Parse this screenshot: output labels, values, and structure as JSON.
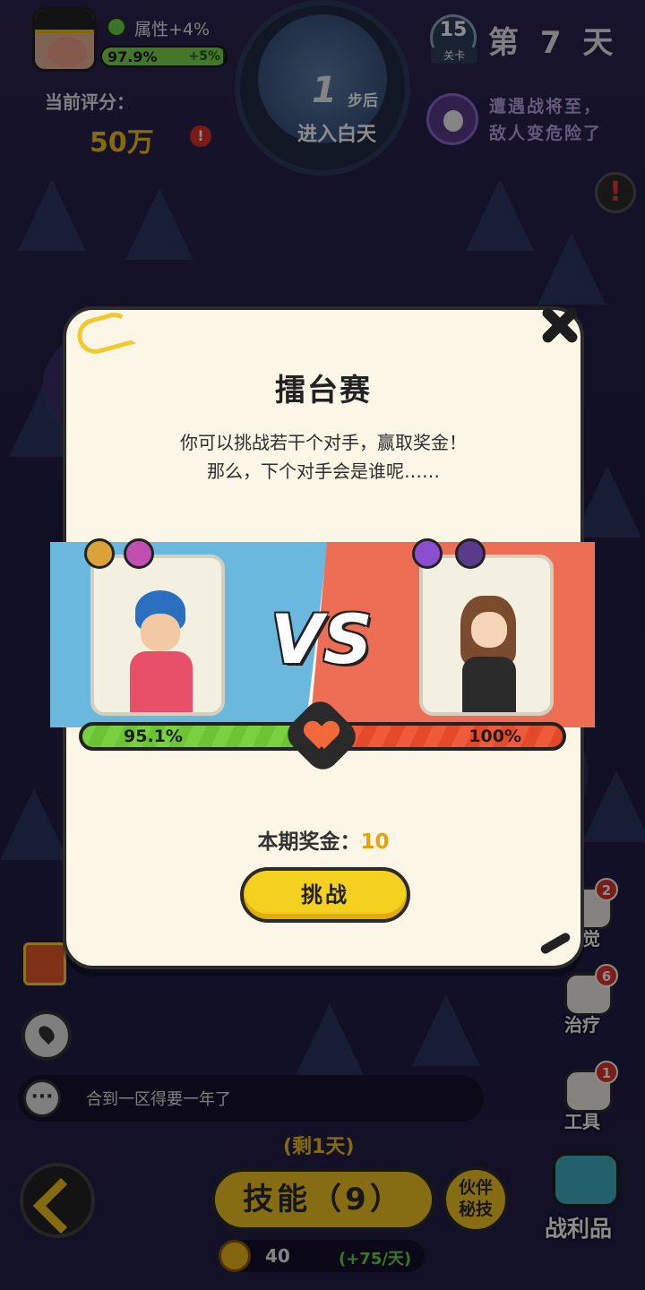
{
  "hud": {
    "attr_text": "属性+4%",
    "hp_percent": "97.9%",
    "hp_plus": "+5%",
    "hp_fraction": 0.979,
    "score_label": "当前评分：",
    "score_value": "50万",
    "warn_mark": "!",
    "dial_steps": "1",
    "dial_after": "步后",
    "dial_enter": "进入白天",
    "level_num": "15",
    "level_tag": "关卡",
    "day": "第 7 天",
    "enemy_line1": "遭遇战将至，",
    "enemy_line2": "敌人变危险了",
    "alert_mark": "!"
  },
  "modal": {
    "title": "擂台赛",
    "desc_line1": "你可以挑战若干个对手，赢取奖金！",
    "desc_line2": "那么，下个对手会是谁呢……",
    "vs_text": "VS",
    "left_power": "95.1%",
    "right_power": "100%",
    "prize_label": "本期奖金：",
    "prize_value": "10",
    "challenge_label": "挑战",
    "colors": {
      "left_band": "#6bb8df",
      "right_band": "#ee6d55",
      "button": "#f4d11e"
    }
  },
  "bottom": {
    "chat_icon": "···",
    "chat_text": "合到一区得要一年了",
    "side": [
      {
        "label": "警觉",
        "badge": "2",
        "icon": "alert-icon"
      },
      {
        "label": "治疗",
        "badge": "6",
        "icon": "heal-icon"
      },
      {
        "label": "工具",
        "badge": "1",
        "icon": "tool-icon"
      }
    ],
    "remain": "(剩1天)",
    "skill_label": "技能（9）",
    "partner_line1": "伙伴",
    "partner_line2": "秘技",
    "loot_label": "战利品",
    "coin_value": "40",
    "coin_rate": "(+75/天)"
  }
}
